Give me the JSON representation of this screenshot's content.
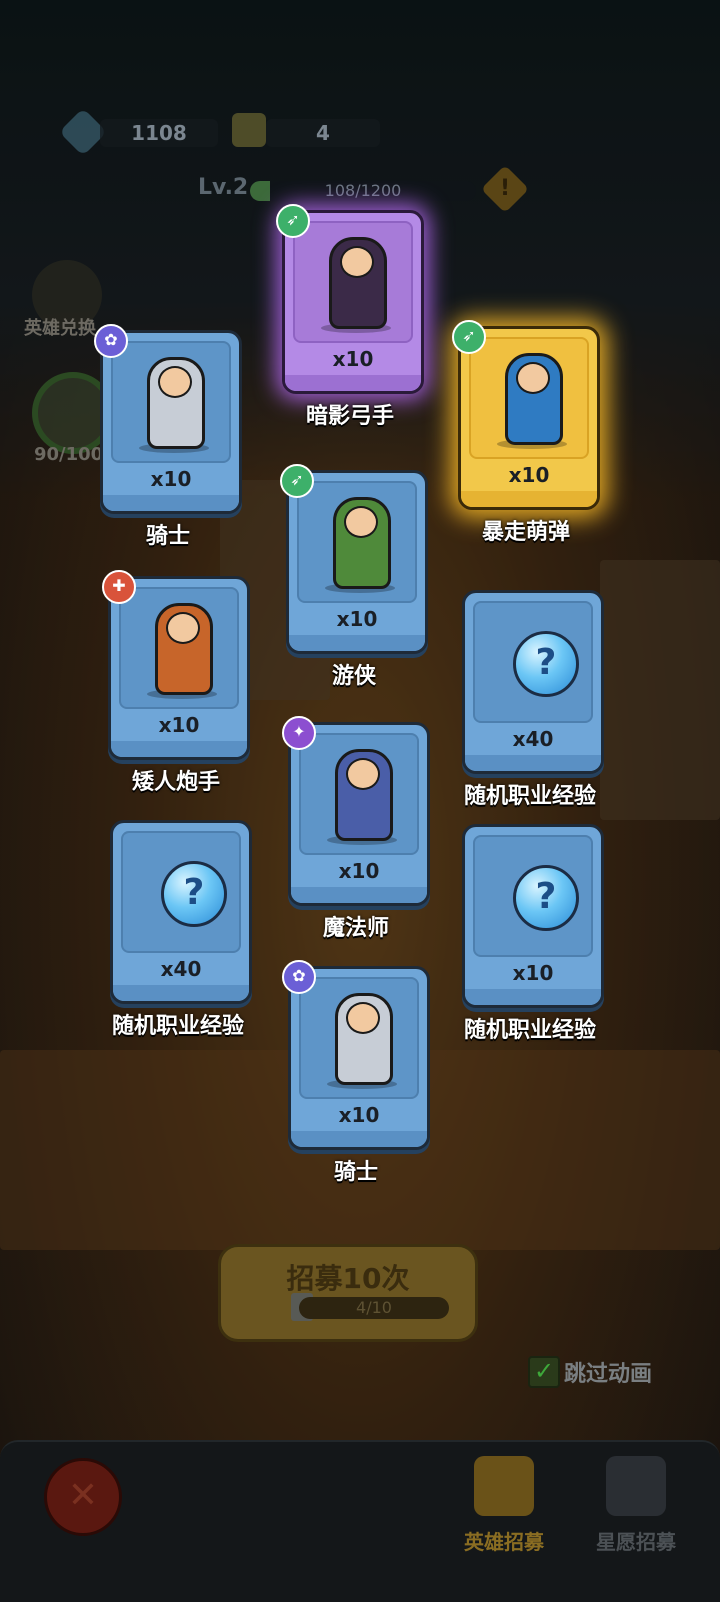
{
  "resources": {
    "gems": "1108",
    "tickets": "4"
  },
  "level": {
    "label": "Lv.2",
    "progress_text": "108/1200",
    "progress": 0.09
  },
  "side": {
    "hero_exchange_label": "英雄兑换",
    "star_progress": "90/100"
  },
  "cards": [
    {
      "name": "暗影弓手",
      "qty": "x10",
      "rarity": "purple",
      "badge": "bow-icon",
      "art": "shadow-archer-icon"
    },
    {
      "name": "骑士",
      "qty": "x10",
      "rarity": "blue",
      "badge": "paw-icon",
      "art": "knight-icon"
    },
    {
      "name": "暴走萌弹",
      "qty": "x10",
      "rarity": "gold",
      "badge": "bow-icon",
      "art": "cannon-girl-icon"
    },
    {
      "name": "游侠",
      "qty": "x10",
      "rarity": "blue",
      "badge": "bow-icon",
      "art": "ranger-icon"
    },
    {
      "name": "矮人炮手",
      "qty": "x10",
      "rarity": "blue",
      "badge": "cannon-icon",
      "art": "dwarf-gunner-icon"
    },
    {
      "name": "随机职业经验",
      "qty": "x40",
      "rarity": "blue",
      "badge": null,
      "art": "question-orb-icon"
    },
    {
      "name": "魔法师",
      "qty": "x10",
      "rarity": "blue",
      "badge": "wand-icon",
      "art": "wizard-icon"
    },
    {
      "name": "随机职业经验",
      "qty": "x40",
      "rarity": "blue",
      "badge": null,
      "art": "question-orb-icon"
    },
    {
      "name": "随机职业经验",
      "qty": "x10",
      "rarity": "blue",
      "badge": null,
      "art": "question-orb-icon"
    },
    {
      "name": "骑士",
      "qty": "x10",
      "rarity": "blue",
      "badge": "paw-icon",
      "art": "knight-icon"
    }
  ],
  "orb_symbol": "?",
  "recruit": {
    "title": "招募10次",
    "progress": "4/10"
  },
  "skip_animation": {
    "label": "跳过动画",
    "checked": true,
    "check_symbol": "✓"
  },
  "bottom_tabs": [
    {
      "label": "英雄招募",
      "active": true
    },
    {
      "label": "星愿招募",
      "active": false
    }
  ],
  "close_symbol": "✕",
  "colors": {
    "purple_glow": "#be6eff",
    "gold_glow": "#ffbe28",
    "card_blue": "#6fa6d8"
  }
}
